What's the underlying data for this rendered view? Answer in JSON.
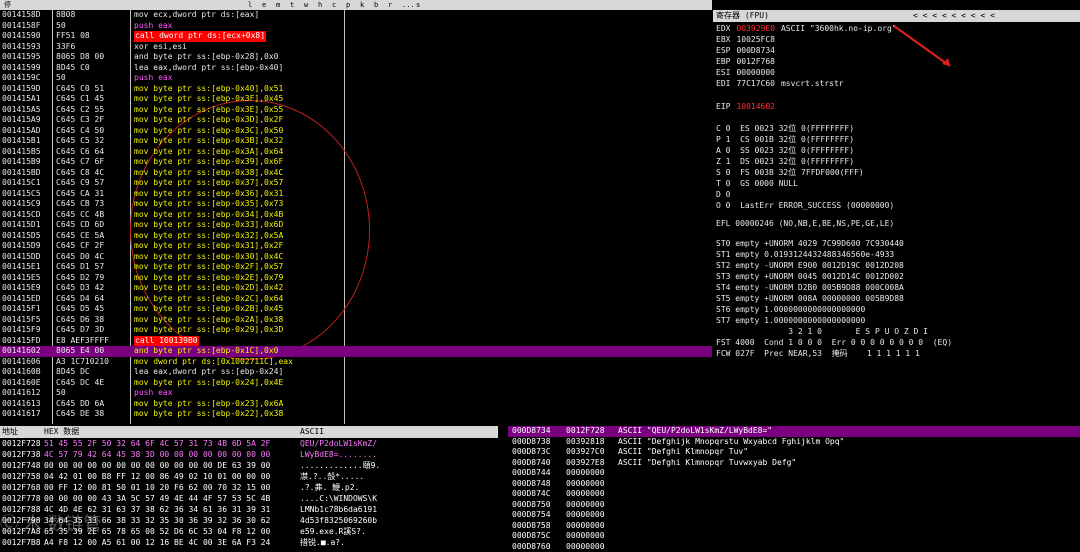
{
  "toolbar": {
    "items": [
      "停",
      "l",
      "e",
      "m",
      "t",
      "w",
      "h",
      "c",
      "p",
      "k",
      "b",
      "r",
      "...",
      "s"
    ]
  },
  "disasm": {
    "rows": [
      [
        "0014158D",
        "8B08",
        "mov ecx,dword ptr ds:[eax]",
        "n"
      ],
      [
        "0014158F",
        "50",
        "push eax",
        "p"
      ],
      [
        "00141590",
        "FF51 08",
        "call dword ptr ds:[ecx+0x8]",
        "c"
      ],
      [
        "00141593",
        "33F6",
        "xor esi,esi",
        "n"
      ],
      [
        "00141595",
        "8065 D8 00",
        "and byte ptr ss:[ebp-0x28],0x0",
        "n"
      ],
      [
        "00141599",
        "8D45 C0",
        "lea eax,dword ptr ss:[ebp-0x40]",
        "n"
      ],
      [
        "0014159C",
        "50",
        "push eax",
        "p"
      ],
      [
        "0014159D",
        "C645 C0 51",
        "mov byte ptr ss:[ebp-0x40],0x51",
        "y"
      ],
      [
        "001415A1",
        "C645 C1 45",
        "mov byte ptr ss:[ebp-0x3F],0x45",
        "y"
      ],
      [
        "001415A5",
        "C645 C2 55",
        "mov byte ptr ss:[ebp-0x3E],0x55",
        "y"
      ],
      [
        "001415A9",
        "C645 C3 2F",
        "mov byte ptr ss:[ebp-0x3D],0x2F",
        "y"
      ],
      [
        "001415AD",
        "C645 C4 50",
        "mov byte ptr ss:[ebp-0x3C],0x50",
        "y"
      ],
      [
        "001415B1",
        "C645 C5 32",
        "mov byte ptr ss:[ebp-0x3B],0x32",
        "y"
      ],
      [
        "001415B5",
        "C645 C6 64",
        "mov byte ptr ss:[ebp-0x3A],0x64",
        "y"
      ],
      [
        "001415B9",
        "C645 C7 6F",
        "mov byte ptr ss:[ebp-0x39],0x6F",
        "y"
      ],
      [
        "001415BD",
        "C645 C8 4C",
        "mov byte ptr ss:[ebp-0x38],0x4C",
        "y"
      ],
      [
        "001415C1",
        "C645 C9 57",
        "mov byte ptr ss:[ebp-0x37],0x57",
        "y"
      ],
      [
        "001415C5",
        "C645 CA 31",
        "mov byte ptr ss:[ebp-0x36],0x31",
        "y"
      ],
      [
        "001415C9",
        "C645 CB 73",
        "mov byte ptr ss:[ebp-0x35],0x73",
        "y"
      ],
      [
        "001415CD",
        "C645 CC 4B",
        "mov byte ptr ss:[ebp-0x34],0x4B",
        "y"
      ],
      [
        "001415D1",
        "C645 CD 6D",
        "mov byte ptr ss:[ebp-0x33],0x6D",
        "y"
      ],
      [
        "001415D5",
        "C645 CE 5A",
        "mov byte ptr ss:[ebp-0x32],0x5A",
        "y"
      ],
      [
        "001415D9",
        "C645 CF 2F",
        "mov byte ptr ss:[ebp-0x31],0x2F",
        "y"
      ],
      [
        "001415DD",
        "C645 D0 4C",
        "mov byte ptr ss:[ebp-0x30],0x4C",
        "y"
      ],
      [
        "001415E1",
        "C645 D1 57",
        "mov byte ptr ss:[ebp-0x2F],0x57",
        "y"
      ],
      [
        "001415E5",
        "C645 D2 79",
        "mov byte ptr ss:[ebp-0x2E],0x79",
        "y"
      ],
      [
        "001415E9",
        "C645 D3 42",
        "mov byte ptr ss:[ebp-0x2D],0x42",
        "y"
      ],
      [
        "001415ED",
        "C645 D4 64",
        "mov byte ptr ss:[ebp-0x2C],0x64",
        "y"
      ],
      [
        "001415F1",
        "C645 D5 45",
        "mov byte ptr ss:[ebp-0x2B],0x45",
        "y"
      ],
      [
        "001415F5",
        "C645 D6 38",
        "mov byte ptr ss:[ebp-0x2A],0x38",
        "y"
      ],
      [
        "001415F9",
        "C645 D7 3D",
        "mov byte ptr ss:[ebp-0x29],0x3D",
        "y"
      ],
      [
        "001415FD",
        "E8 AEF3FFFF",
        "call 100139B0",
        "c"
      ],
      [
        "00141602",
        "8065 E4 00",
        "and byte ptr ss:[ebp-0x1C],0x0",
        "cur"
      ],
      [
        "00141606",
        "A3 1C710210",
        "mov dword ptr ds:[0x1002711C],eax",
        "y"
      ],
      [
        "0014160B",
        "8D45 DC",
        "lea eax,dword ptr ss:[ebp-0x24]",
        "n"
      ],
      [
        "0014160E",
        "C645 DC 4E",
        "mov byte ptr ss:[ebp-0x24],0x4E",
        "y"
      ],
      [
        "00141612",
        "50",
        "push eax",
        "p"
      ],
      [
        "00141613",
        "C645 DD 6A",
        "mov byte ptr ss:[ebp-0x23],0x6A",
        "y"
      ],
      [
        "00141617",
        "C645 DE 38",
        "mov byte ptr ss:[ebp-0x22],0x38",
        "y"
      ]
    ]
  },
  "regs": {
    "title": "寄存器 (FPU)",
    "nav": "<   <   <   <   <   <   <   <   <",
    "lines": [
      [
        "EDX",
        "003929E0",
        "ASCII \"3600hk.no-ip.org\""
      ],
      [
        "EBX",
        "10025FC8",
        ""
      ],
      [
        "ESP",
        "000D8734",
        ""
      ],
      [
        "EBP",
        "0012F768",
        ""
      ],
      [
        "ESI",
        "00000000",
        ""
      ],
      [
        "EDI",
        "77C17C60",
        "msvcrt.strstr"
      ]
    ],
    "eip": [
      "EIP",
      "10014602"
    ],
    "flags": [
      "C 0  ES 0023 32位 0(FFFFFFFF)",
      "P 1  CS 001B 32位 0(FFFFFFFF)",
      "A 0  SS 0023 32位 0(FFFFFFFF)",
      "Z 1  DS 0023 32位 0(FFFFFFFF)",
      "S 0  FS 003B 32位 7FFDF000(FFF)",
      "T 0  GS 0000 NULL",
      "D 0",
      "O 0  LastErr ERROR_SUCCESS (00000000)"
    ],
    "efl": "EFL 00000246 (NO,NB,E,BE,NS,PE,GE,LE)",
    "st": [
      "ST0 empty +UNORM 4029 7C99D600 7C930440",
      "ST1 empty 0.0193124432488346560e-4933",
      "ST2 empty -UNORM E900 0012D19C 0012D208",
      "ST3 empty +UNORM 0045 0012D14C 0012D002",
      "ST4 empty -UNORM D2B0 005B9D88 000C008A",
      "ST5 empty +UNORM 008A 00000000 005B9D88",
      "ST6 empty 1.0000000000000000000",
      "ST7 empty 1.0000000000000000000"
    ],
    "fbits": "               3 2 1 0       E S P U O Z D I",
    "fst": "FST 4000  Cond 1 0 0 0  Err 0 0 0 0 0 0 0 0  (EQ)",
    "fcw": "FCW 027F  Prec NEAR,53  掩码    1 1 1 1 1 1"
  },
  "dump": {
    "header": [
      "地址",
      "HEX 数据",
      "ASCII"
    ],
    "rows": [
      [
        "0012F728",
        "51 45 55 2F 50 32 64 6F 4C 57 31 73 4B 6D 5A 2F",
        "QEU/P2doLW1sKmZ/"
      ],
      [
        "0012F738",
        "4C 57 79 42 64 45 38 3D 00 00 00 00 00 00 00 00",
        "LWyBdE8=........"
      ],
      [
        "0012F748",
        "00 00 00 00 00 00 00 00 00 00 00 00 DE 63 39 00",
        ".............頤9."
      ],
      [
        "0012F758",
        "04 42 01 00 B8 FF 12 00 86 49 02 10 01 00 00 00",
        "凚.?..嗀*....."
      ],
      [
        "0012F768",
        "00 FF 12 00 81 50 01 10 20 F6 62 00 70 32 15 00",
        ".?.丳. 鯾.p2."
      ],
      [
        "0012F778",
        "00 00 00 00 43 3A 5C 57 49 4E 44 4F 57 53 5C 4B",
        "....C:\\WINDOWS\\K"
      ],
      [
        "0012F788",
        "4C 4D 4E 62 31 63 37 38 62 36 34 61 36 31 39 31",
        "LMNb1c78b6da6191"
      ],
      [
        "0012F798",
        "34 64 35 33 66 38 33 32 35 30 36 39 32 36 30 62",
        "4d53f8325069260b"
      ],
      [
        "0012F7A8",
        "65 35 39 2E 65 78 65 00 52 D6 6C 53 04 F8 12 00",
        "e59.exe.R謑S?."
      ],
      [
        "0012F7B8",
        "A4 F8 12 00 A5 61 00 12 16 BE 4C 00 3E 6A F3 24",
        "措锐.■.a?."
      ]
    ]
  },
  "stack": {
    "rows": [
      [
        "000D8734",
        "0012F728",
        "ASCII \"QEU/P2doLW1sKmZ/LWyBdE8=\""
      ],
      [
        "000D8738",
        "00392818",
        "ASCII \"Defghijk Mnopqrstu Wxyabcd Fghijklm Opq\""
      ],
      [
        "000D873C",
        "003927C0",
        "ASCII \"Defghi Klmnopqr Tuv\""
      ],
      [
        "000D8740",
        "003927E8",
        "ASCII \"Defghi Klmnopqr Tuvwxyab Defg\""
      ],
      [
        "000D8744",
        "00000000",
        ""
      ],
      [
        "000D8748",
        "00000000",
        ""
      ],
      [
        "000D874C",
        "00000000",
        ""
      ],
      [
        "000D8750",
        "00000000",
        ""
      ],
      [
        "000D8754",
        "00000000",
        ""
      ],
      [
        "000D8758",
        "00000000",
        ""
      ],
      [
        "000D875C",
        "00000000",
        ""
      ],
      [
        "000D8760",
        "00000000",
        ""
      ]
    ]
  },
  "watermark": "Ⓒ 木 数链管"
}
